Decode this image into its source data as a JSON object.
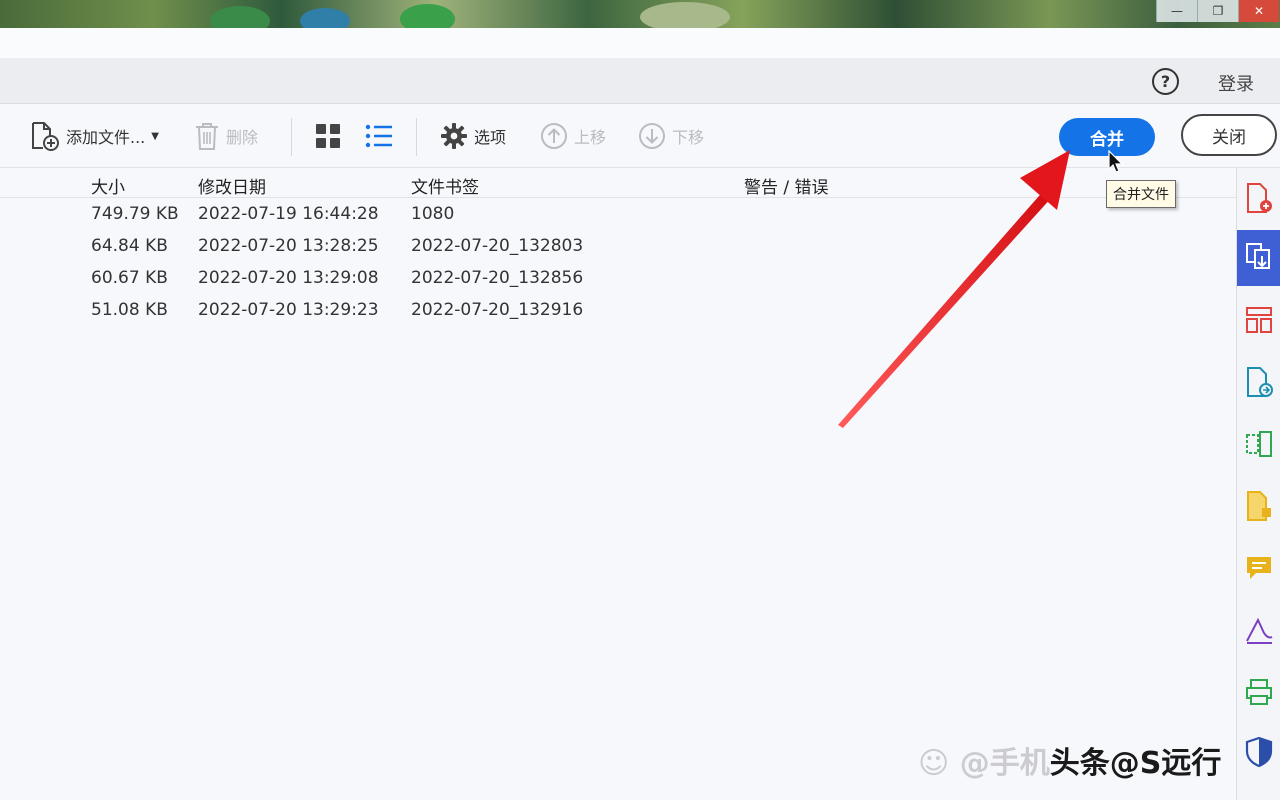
{
  "window": {
    "controls": {
      "minimize": "—",
      "restore": "❐",
      "close": "✕"
    }
  },
  "header": {
    "help_label": "?",
    "login_label": "登录"
  },
  "toolbar": {
    "add_files_label": "添加文件...",
    "delete_label": "删除",
    "options_label": "选项",
    "move_up_label": "上移",
    "move_down_label": "下移",
    "merge_label": "合并",
    "close_label": "关闭"
  },
  "tooltip": {
    "text": "合并文件"
  },
  "table": {
    "columns": [
      "大小",
      "修改日期",
      "文件书签",
      "警告 / 错误"
    ],
    "rows": [
      {
        "size": "749.79 KB",
        "modified": "2022-07-19 16:44:28",
        "bookmark": "1080",
        "warning": ""
      },
      {
        "size": "64.84 KB",
        "modified": "2022-07-20 13:28:25",
        "bookmark": "2022-07-20_132803",
        "warning": ""
      },
      {
        "size": "60.67 KB",
        "modified": "2022-07-20 13:29:08",
        "bookmark": "2022-07-20_132856",
        "warning": ""
      },
      {
        "size": "51.08 KB",
        "modified": "2022-07-20 13:29:23",
        "bookmark": "2022-07-20_132916",
        "warning": ""
      }
    ]
  },
  "rail": {
    "items": [
      {
        "icon": "create-pdf-icon",
        "color": "#e0443e"
      },
      {
        "icon": "combine-files-icon",
        "color": "#ffffff",
        "active": true
      },
      {
        "icon": "organize-pages-icon",
        "color": "#e0443e"
      },
      {
        "icon": "export-pdf-icon",
        "color": "#1b8fb0"
      },
      {
        "icon": "edit-pdf-icon",
        "color": "#2fa84f"
      },
      {
        "icon": "fill-sign-icon",
        "color": "#e8b21a"
      },
      {
        "icon": "comment-icon",
        "color": "#e8b21a"
      },
      {
        "icon": "signature-icon",
        "color": "#7b3fc4"
      },
      {
        "icon": "scan-icon",
        "color": "#2fa84f"
      },
      {
        "icon": "protect-icon",
        "color": "#2b4fa8"
      }
    ]
  },
  "colors": {
    "accent": "#1473e6",
    "annotation_arrow": "#e3161c"
  },
  "watermark": {
    "faded": "☺ @手机",
    "strong": "头条@S远行"
  }
}
